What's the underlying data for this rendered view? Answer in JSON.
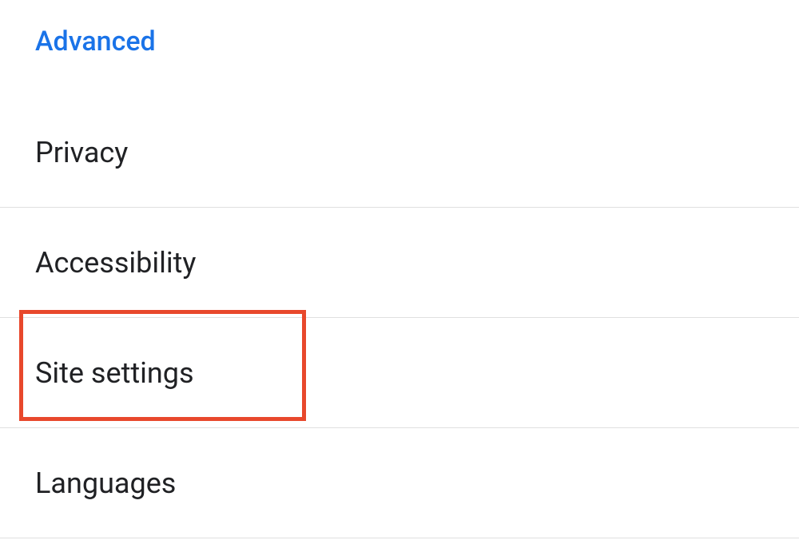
{
  "section": {
    "header": "Advanced"
  },
  "menu": {
    "items": [
      {
        "label": "Privacy"
      },
      {
        "label": "Accessibility"
      },
      {
        "label": "Site settings"
      },
      {
        "label": "Languages"
      }
    ]
  }
}
